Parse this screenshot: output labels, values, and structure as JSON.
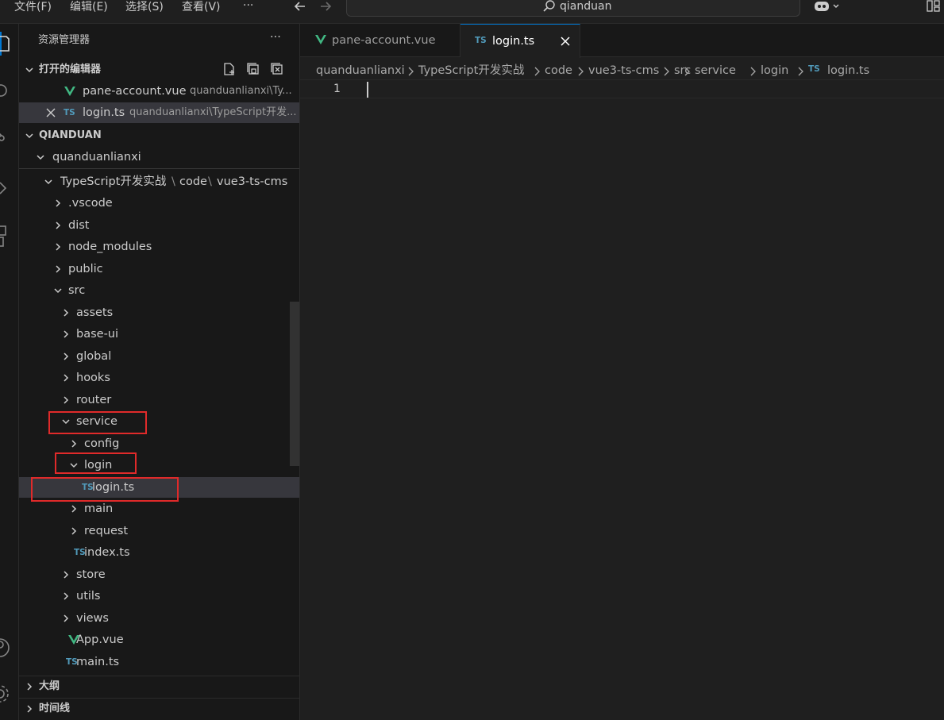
{
  "menubar": {
    "items": [
      "文件(F)",
      "编辑(E)",
      "选择(S)",
      "查看(V)",
      "···"
    ],
    "search_text": "qianduan"
  },
  "sidebar": {
    "title": "资源管理器",
    "more_label": "···",
    "open_editors": {
      "header": "打开的编辑器",
      "items": [
        {
          "name": "pane-account.vue",
          "path": "quanduanlianxi\\Ty..."
        },
        {
          "name": "login.ts",
          "path": "quanduanlianxi\\TypeScript开发..."
        }
      ]
    },
    "workspace": {
      "header": "QIANDUAN",
      "root": "quanduanlianxi",
      "compact_path": [
        "TypeScript开发实战",
        "code",
        "vue3-ts-cms"
      ],
      "path_sep": "\\",
      "tree": [
        {
          "label": ".vscode",
          "depth": 0,
          "kind": "folder",
          "state": "collapsed"
        },
        {
          "label": "dist",
          "depth": 0,
          "kind": "folder",
          "state": "collapsed"
        },
        {
          "label": "node_modules",
          "depth": 0,
          "kind": "folder",
          "state": "collapsed"
        },
        {
          "label": "public",
          "depth": 0,
          "kind": "folder",
          "state": "collapsed"
        },
        {
          "label": "src",
          "depth": 0,
          "kind": "folder",
          "state": "expanded"
        },
        {
          "label": "assets",
          "depth": 1,
          "kind": "folder",
          "state": "collapsed"
        },
        {
          "label": "base-ui",
          "depth": 1,
          "kind": "folder",
          "state": "collapsed"
        },
        {
          "label": "global",
          "depth": 1,
          "kind": "folder",
          "state": "collapsed"
        },
        {
          "label": "hooks",
          "depth": 1,
          "kind": "folder",
          "state": "collapsed"
        },
        {
          "label": "router",
          "depth": 1,
          "kind": "folder",
          "state": "collapsed"
        },
        {
          "label": "service",
          "depth": 1,
          "kind": "folder",
          "state": "expanded",
          "highlighted": true
        },
        {
          "label": "config",
          "depth": 2,
          "kind": "folder",
          "state": "collapsed"
        },
        {
          "label": "login",
          "depth": 2,
          "kind": "folder",
          "state": "expanded",
          "highlighted": true
        },
        {
          "label": "login.ts",
          "depth": 3,
          "kind": "ts",
          "selected": true,
          "highlighted": true
        },
        {
          "label": "main",
          "depth": 2,
          "kind": "folder",
          "state": "collapsed"
        },
        {
          "label": "request",
          "depth": 2,
          "kind": "folder",
          "state": "collapsed"
        },
        {
          "label": "index.ts",
          "depth": 2,
          "kind": "ts"
        },
        {
          "label": "store",
          "depth": 1,
          "kind": "folder",
          "state": "collapsed"
        },
        {
          "label": "utils",
          "depth": 1,
          "kind": "folder",
          "state": "collapsed"
        },
        {
          "label": "views",
          "depth": 1,
          "kind": "folder",
          "state": "collapsed"
        },
        {
          "label": "App.vue",
          "depth": 1,
          "kind": "vue"
        },
        {
          "label": "main.ts",
          "depth": 1,
          "kind": "ts"
        }
      ]
    },
    "outline_header": "大纲",
    "timeline_header": "时间线",
    "ts_badge": "TS"
  },
  "editor": {
    "tabs": [
      {
        "label": "pane-account.vue",
        "active": false
      },
      {
        "label": "login.ts",
        "active": true
      }
    ],
    "breadcrumbs": [
      "quanduanlianxi",
      "TypeScript开发实战",
      "code",
      "vue3-ts-cms",
      "src",
      "service",
      "login",
      "login.ts"
    ],
    "line_numbers": [
      "1"
    ]
  },
  "colors": {
    "highlight_box": "#e02a2a",
    "ts_blue": "#519aba",
    "vue_green": "#41b883",
    "background": "#1f1f1f"
  }
}
